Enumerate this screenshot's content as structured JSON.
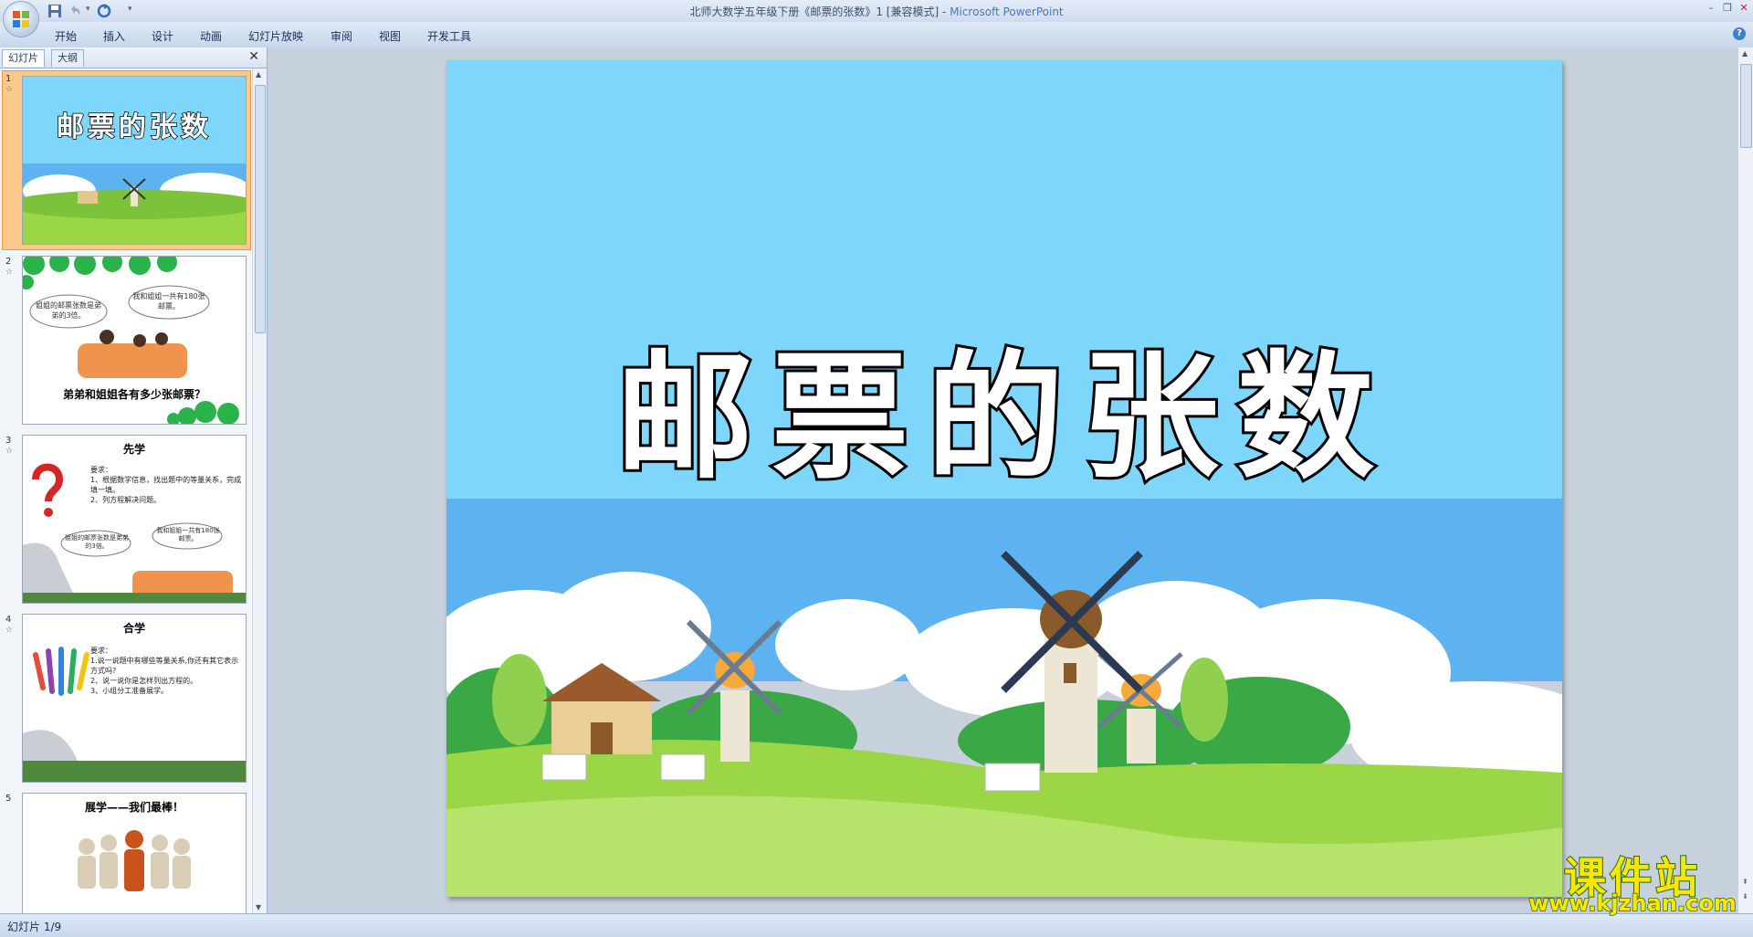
{
  "window": {
    "title_doc": "北师大数学五年级下册《邮票的张数》1 [兼容模式] - ",
    "title_app": "Microsoft PowerPoint"
  },
  "ribbon": {
    "tabs": [
      "开始",
      "插入",
      "设计",
      "动画",
      "幻灯片放映",
      "审阅",
      "视图",
      "开发工具"
    ]
  },
  "left_panel": {
    "tab_slides": "幻灯片",
    "tab_outline": "大纲",
    "thumbnails": [
      {
        "num": "1",
        "title": "邮票的张数"
      },
      {
        "num": "2",
        "bubble_left": "姐姐的邮票张数是弟弟的3倍。",
        "bubble_right": "我和姐姐一共有180张邮票。",
        "caption": "弟弟和姐姐各有多少张邮票？"
      },
      {
        "num": "3",
        "title": "先学",
        "req_label": "要求：",
        "req_1": "1、根据数学信息，找出题中的等量关系，完成填一填。",
        "req_2": "2、列方程解决问题。",
        "bubble_left": "姐姐的邮票张数是弟弟的3倍。",
        "bubble_right": "我和姐姐一共有180张邮票。"
      },
      {
        "num": "4",
        "title": "合学",
        "req_label": "要求：",
        "req_1": "1.说一说题中有哪些等量关系,你还有其它表示方式吗?",
        "req_2": "2、说一说你是怎样列出方程的。",
        "req_3": "3、小组分工准备展学。"
      },
      {
        "num": "5",
        "title": "展学——我们最棒！"
      }
    ]
  },
  "slide": {
    "title": "邮票的张数"
  },
  "status": {
    "text": "幻灯片 1/9"
  },
  "watermark": {
    "cn": "课件站",
    "url": "www.kjzhan.com"
  },
  "colors": {
    "sky": "#7ed6fb",
    "sea": "#5cb3ef",
    "grass": "#9ad645",
    "accent_orange": "#f7a93b"
  }
}
